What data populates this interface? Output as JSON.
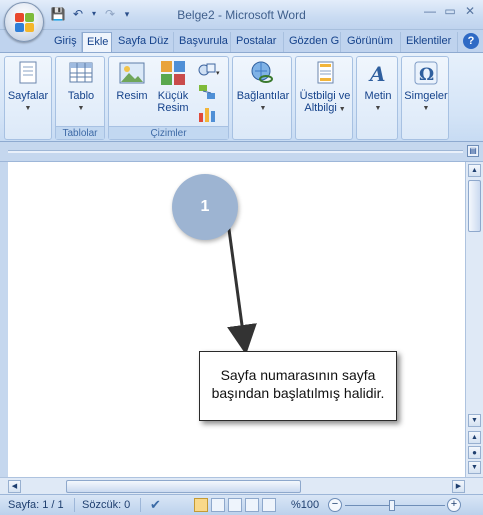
{
  "window": {
    "title": "Belge2 - Microsoft Word"
  },
  "colors": {
    "ribbon_text": "#15428b",
    "accent": "#2f6ac5"
  },
  "quick_access": [
    {
      "name": "save-icon",
      "glyph": "▣"
    },
    {
      "name": "undo-icon",
      "glyph": "↶"
    },
    {
      "name": "redo-icon",
      "glyph": "↷"
    },
    {
      "name": "customize-icon",
      "glyph": "▾"
    }
  ],
  "tabs": [
    {
      "label": "Giriş"
    },
    {
      "label": "Ekle",
      "active": true
    },
    {
      "label": "Sayfa Düz"
    },
    {
      "label": "Başvurula"
    },
    {
      "label": "Postalar"
    },
    {
      "label": "Gözden G"
    },
    {
      "label": "Görünüm"
    },
    {
      "label": "Eklentiler"
    }
  ],
  "ribbon": {
    "pages": {
      "label": "Sayfalar"
    },
    "table": {
      "label": "Tablo",
      "group": "Tablolar"
    },
    "picture": {
      "label": "Resim"
    },
    "clipart": {
      "label1": "Küçük",
      "label2": "Resim"
    },
    "illustrations_group": "Çizimler",
    "links": {
      "label": "Bağlantılar"
    },
    "header_footer": {
      "label1": "Üstbilgi ve",
      "label2": "Altbilgi"
    },
    "text": {
      "label": "Metin"
    },
    "symbols": {
      "label": "Simgeler"
    }
  },
  "statusbar": {
    "page": "Sayfa: 1 / 1",
    "words": "Sözcük: 0",
    "zoom": "%100",
    "zoom_minus": "−",
    "zoom_plus": "+"
  },
  "annotation": {
    "step": "1",
    "line1": "Sayfa numarasının sayfa",
    "line2": "başından başlatılmış halidir."
  }
}
